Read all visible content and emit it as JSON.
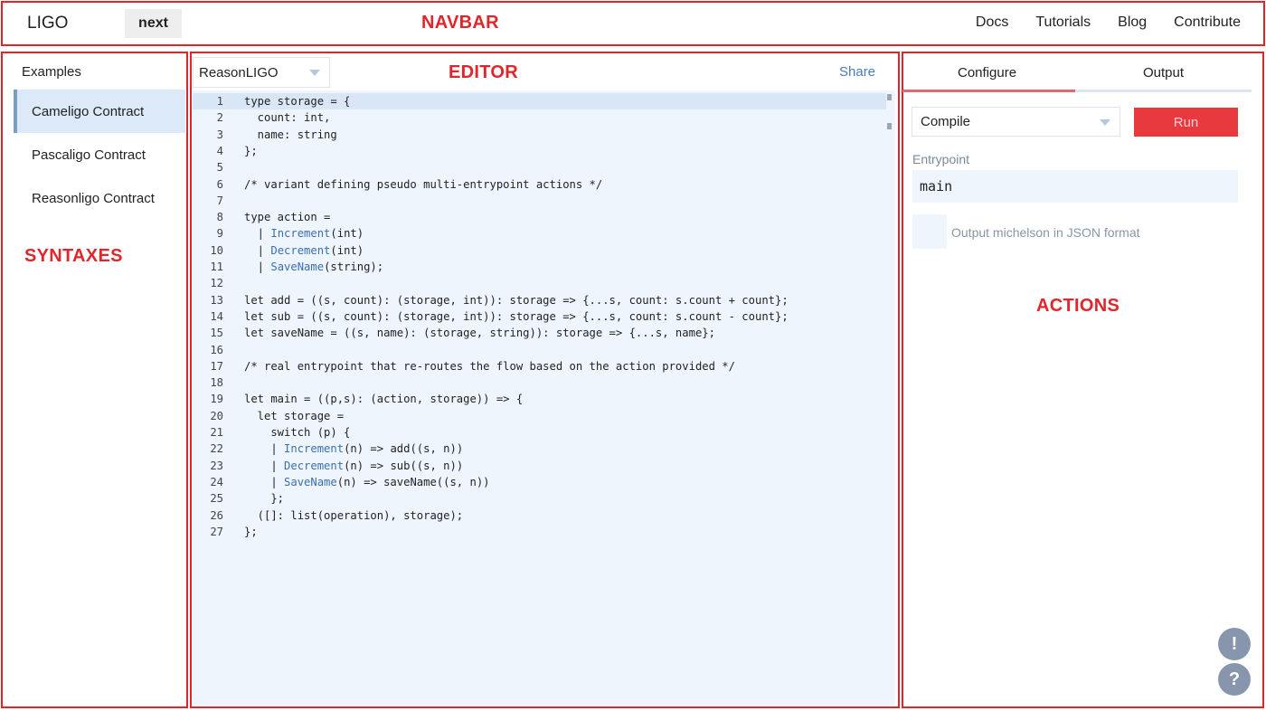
{
  "navbar": {
    "logo": "LIGO",
    "version": "next",
    "links": [
      "Docs",
      "Tutorials",
      "Blog",
      "Contribute"
    ]
  },
  "annotations": {
    "navbar": "NAVBAR",
    "editor": "EDITOR",
    "syntaxes": "SYNTAXES",
    "actions": "ACTIONS"
  },
  "sidebar": {
    "title": "Examples",
    "items": [
      {
        "label": "Cameligo Contract",
        "active": true
      },
      {
        "label": "Pascaligo Contract",
        "active": false
      },
      {
        "label": "Reasonligo Contract",
        "active": false
      }
    ]
  },
  "editor": {
    "syntax": "ReasonLIGO",
    "share_label": "Share",
    "active_line": 1,
    "lines": [
      "type storage = {",
      "  count: int,",
      "  name: string",
      "};",
      "",
      "/* variant defining pseudo multi-entrypoint actions */",
      "",
      "type action =",
      "  | Increment(int)",
      "  | Decrement(int)",
      "  | SaveName(string);",
      "",
      "let add = ((s, count): (storage, int)): storage => {...s, count: s.count + count};",
      "let sub = ((s, count): (storage, int)): storage => {...s, count: s.count - count};",
      "let saveName = ((s, name): (storage, string)): storage => {...s, name};",
      "",
      "/* real entrypoint that re-routes the flow based on the action provided */",
      "",
      "let main = ((p,s): (action, storage)) => {",
      "  let storage =",
      "    switch (p) {",
      "    | Increment(n) => add((s, n))",
      "    | Decrement(n) => sub((s, n))",
      "    | SaveName(n) => saveName((s, n))",
      "    };",
      "  ([]: list(operation), storage);",
      "};"
    ]
  },
  "actions": {
    "tabs": [
      "Configure",
      "Output"
    ],
    "active_tab": "Configure",
    "action": "Compile",
    "run_label": "Run",
    "entrypoint_label": "Entrypoint",
    "entrypoint_value": "main",
    "json_label": "Output michelson in JSON format",
    "json_checked": false,
    "float_buttons": [
      "!",
      "?"
    ]
  }
}
